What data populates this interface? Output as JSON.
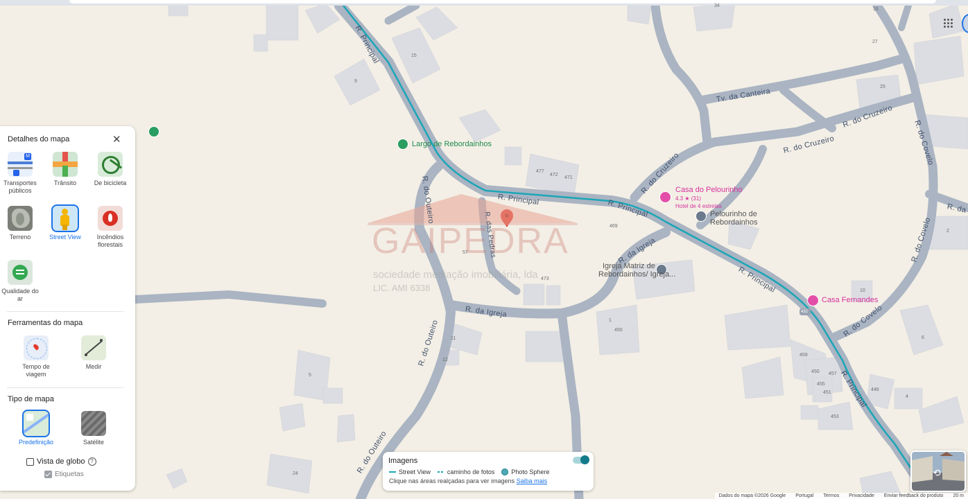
{
  "map": {
    "streets": {
      "principal": "R. Principal",
      "outeiro": "R. do Outeiro",
      "pedras": "R. das Pedras",
      "igreja": "R. da Igreja",
      "cruzeiro": "R. do Cruzeiro",
      "canteira": "Tv. da Canteira",
      "covelo": "R. do Covelo",
      "da_edge": "R. da"
    },
    "places": {
      "largo": "Largo de Rebordainhos",
      "casa_pelourinho": "Casa do Pelourinho",
      "casa_pelourinho_rating": "4.3 ★ (31)",
      "casa_pelourinho_type": "Hotel de 4 estrelas",
      "pelourinho_l1": "Pelourinho de",
      "pelourinho_l2": "Rebordainhos",
      "igreja_l1": "Igreja Matriz de",
      "igreja_l2": "Rebordainhos/ Igreja...",
      "casa_fernandes": "Casa Fernandes"
    },
    "house_numbers": [
      "34",
      "15",
      "9",
      "27",
      "25",
      "16",
      "477",
      "472",
      "471",
      "469",
      "473",
      "57",
      "450",
      "1",
      "11",
      "12",
      "5",
      "24",
      "10",
      "459",
      "450",
      "457",
      "455",
      "451",
      "453",
      "446",
      "4",
      "6",
      "2"
    ],
    "route_marker": "432",
    "watermark": {
      "brand": "GAIPEDRA",
      "tagline": "sociedade mediação imobiliária, lda",
      "license": "LIC. AMI 6338"
    }
  },
  "panel": {
    "details_title": "Detalhes do mapa",
    "details": [
      {
        "label": "Transportes públicos",
        "icon": "transit-icon"
      },
      {
        "label": "Trânsito",
        "icon": "traffic-icon"
      },
      {
        "label": "De bicicleta",
        "icon": "bicycle-icon"
      },
      {
        "label": "Terreno",
        "icon": "terrain-icon"
      },
      {
        "label": "Street View",
        "icon": "street-view-icon",
        "selected": true
      },
      {
        "label": "Incêndios florestais",
        "icon": "wildfire-icon"
      },
      {
        "label": "Qualidade do ar",
        "icon": "air-quality-icon"
      }
    ],
    "tools_title": "Ferramentas do mapa",
    "tools": [
      {
        "label": "Tempo de viagem",
        "icon": "travel-time-icon"
      },
      {
        "label": "Medir",
        "icon": "measure-icon"
      }
    ],
    "type_title": "Tipo de mapa",
    "types": [
      {
        "label": "Predefinição",
        "icon": "default-map-icon",
        "selected": true
      },
      {
        "label": "Satélite",
        "icon": "satellite-icon"
      }
    ],
    "globe_label": "Vista de globo",
    "labels_label": "Etiquetas"
  },
  "imagery": {
    "title": "Imagens",
    "street_view": "Street View",
    "photo_path": "caminho de fotos",
    "photo_sphere": "Photo Sphere",
    "hint": "Clique nas áreas realçadas para ver imagens",
    "learn_more": "Saiba mais"
  },
  "footer": {
    "data": "Dados do mapa ©2026 Google",
    "country": "Portugal",
    "terms": "Termos",
    "privacy": "Privacidade",
    "feedback": "Enviar feedback do produto",
    "scale": "20 m"
  },
  "colors": {
    "land": "#f3efe6",
    "road": "#aab4c2",
    "street_view_line": "#1aa6b7",
    "building": "#dcdde2",
    "accent": "#1a73e8",
    "poi_pink": "#d6319b"
  }
}
